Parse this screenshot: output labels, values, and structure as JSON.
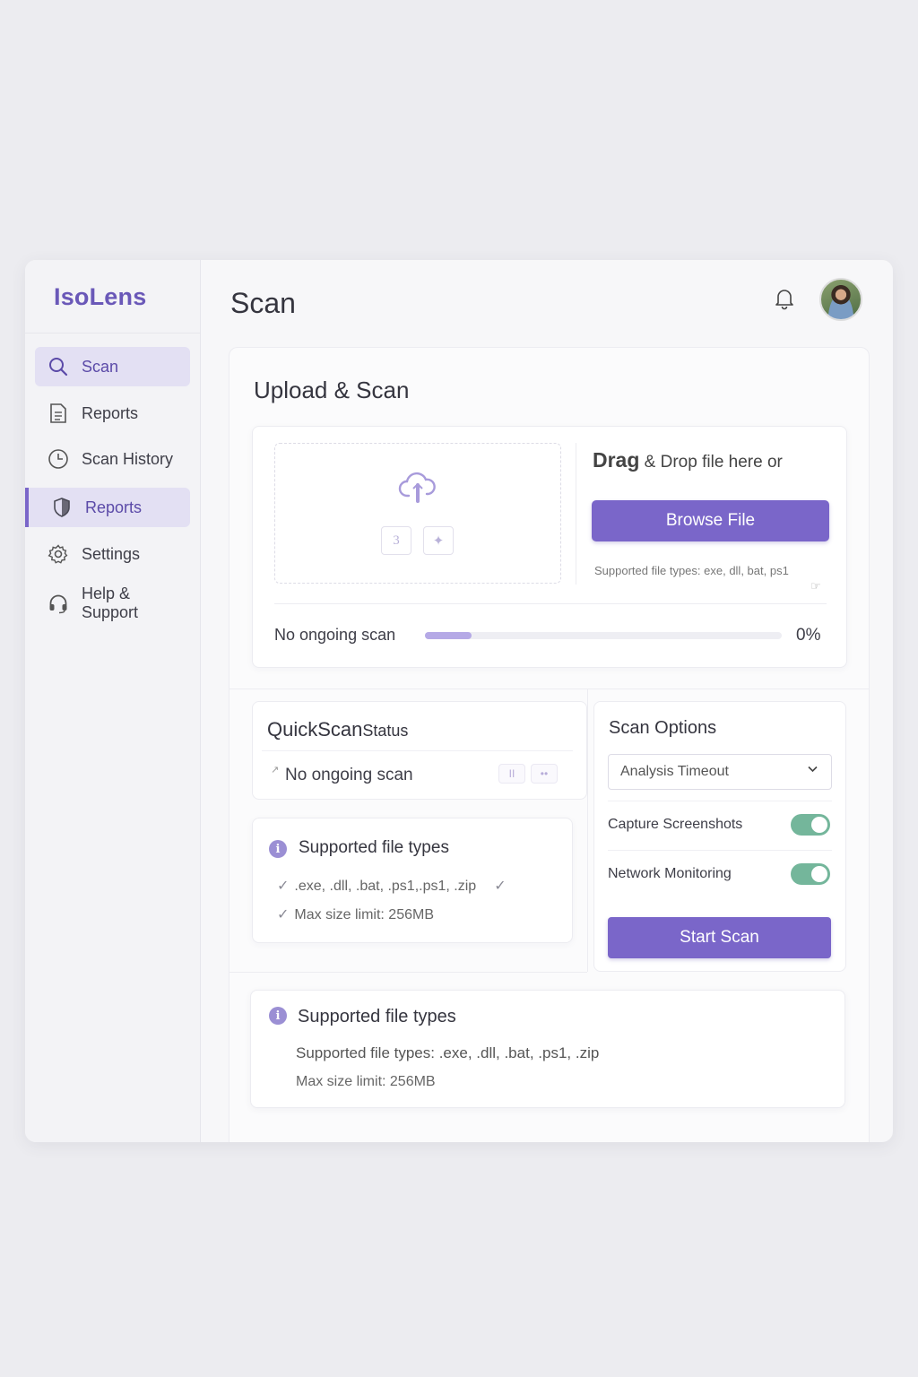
{
  "app": {
    "name": "IsoLens"
  },
  "sidebar": {
    "items": [
      {
        "label": "Scan",
        "icon": "search-icon"
      },
      {
        "label": "Reports",
        "icon": "document-icon"
      },
      {
        "label": "Scan History",
        "icon": "clock-icon"
      },
      {
        "label": "Reports",
        "icon": "shield-icon"
      },
      {
        "label": "Settings",
        "icon": "gear-icon"
      },
      {
        "label": "Help & Support",
        "icon": "headset-icon"
      }
    ]
  },
  "header": {
    "title": "Scan"
  },
  "upload": {
    "title": "Upload & Scan",
    "drag_bold": "Drag",
    "drag_rest": " & Drop file here or",
    "browse_label": "Browse File",
    "supported": "Supported file types: exe, dll, bat, ps1",
    "mini_btn_1": "3",
    "mini_btn_2": "✦",
    "status": "No ongoing scan",
    "progress_percent": 0,
    "progress_label": "0%",
    "progress_indicator_fraction": 0.13
  },
  "quickscan": {
    "title_main": "QuickScan",
    "title_sub": "Status",
    "status": "No ongoing scan",
    "ctl_1": "II",
    "ctl_2": "••"
  },
  "supported_card": {
    "title": "Supported file types",
    "line1": ".exe, .dll, .bat, .ps1,.ps1, .zip",
    "line2": "Max size limit: 256MB"
  },
  "options": {
    "title": "Scan Options",
    "select_value": "Analysis Timeout",
    "toggle1_label": "Capture Screenshots",
    "toggle1_on": true,
    "toggle2_label": "Network Monitoring",
    "toggle2_on": true,
    "start_label": "Start Scan"
  },
  "bottom_card": {
    "title": "Supported file types",
    "line1": "Supported file types: .exe, .dll, .bat, .ps1, .zip",
    "line2": "Max size limit: 256MB"
  },
  "colors": {
    "accent": "#7a66c9",
    "brand": "#6a58b8",
    "toggle": "#74b69b"
  }
}
